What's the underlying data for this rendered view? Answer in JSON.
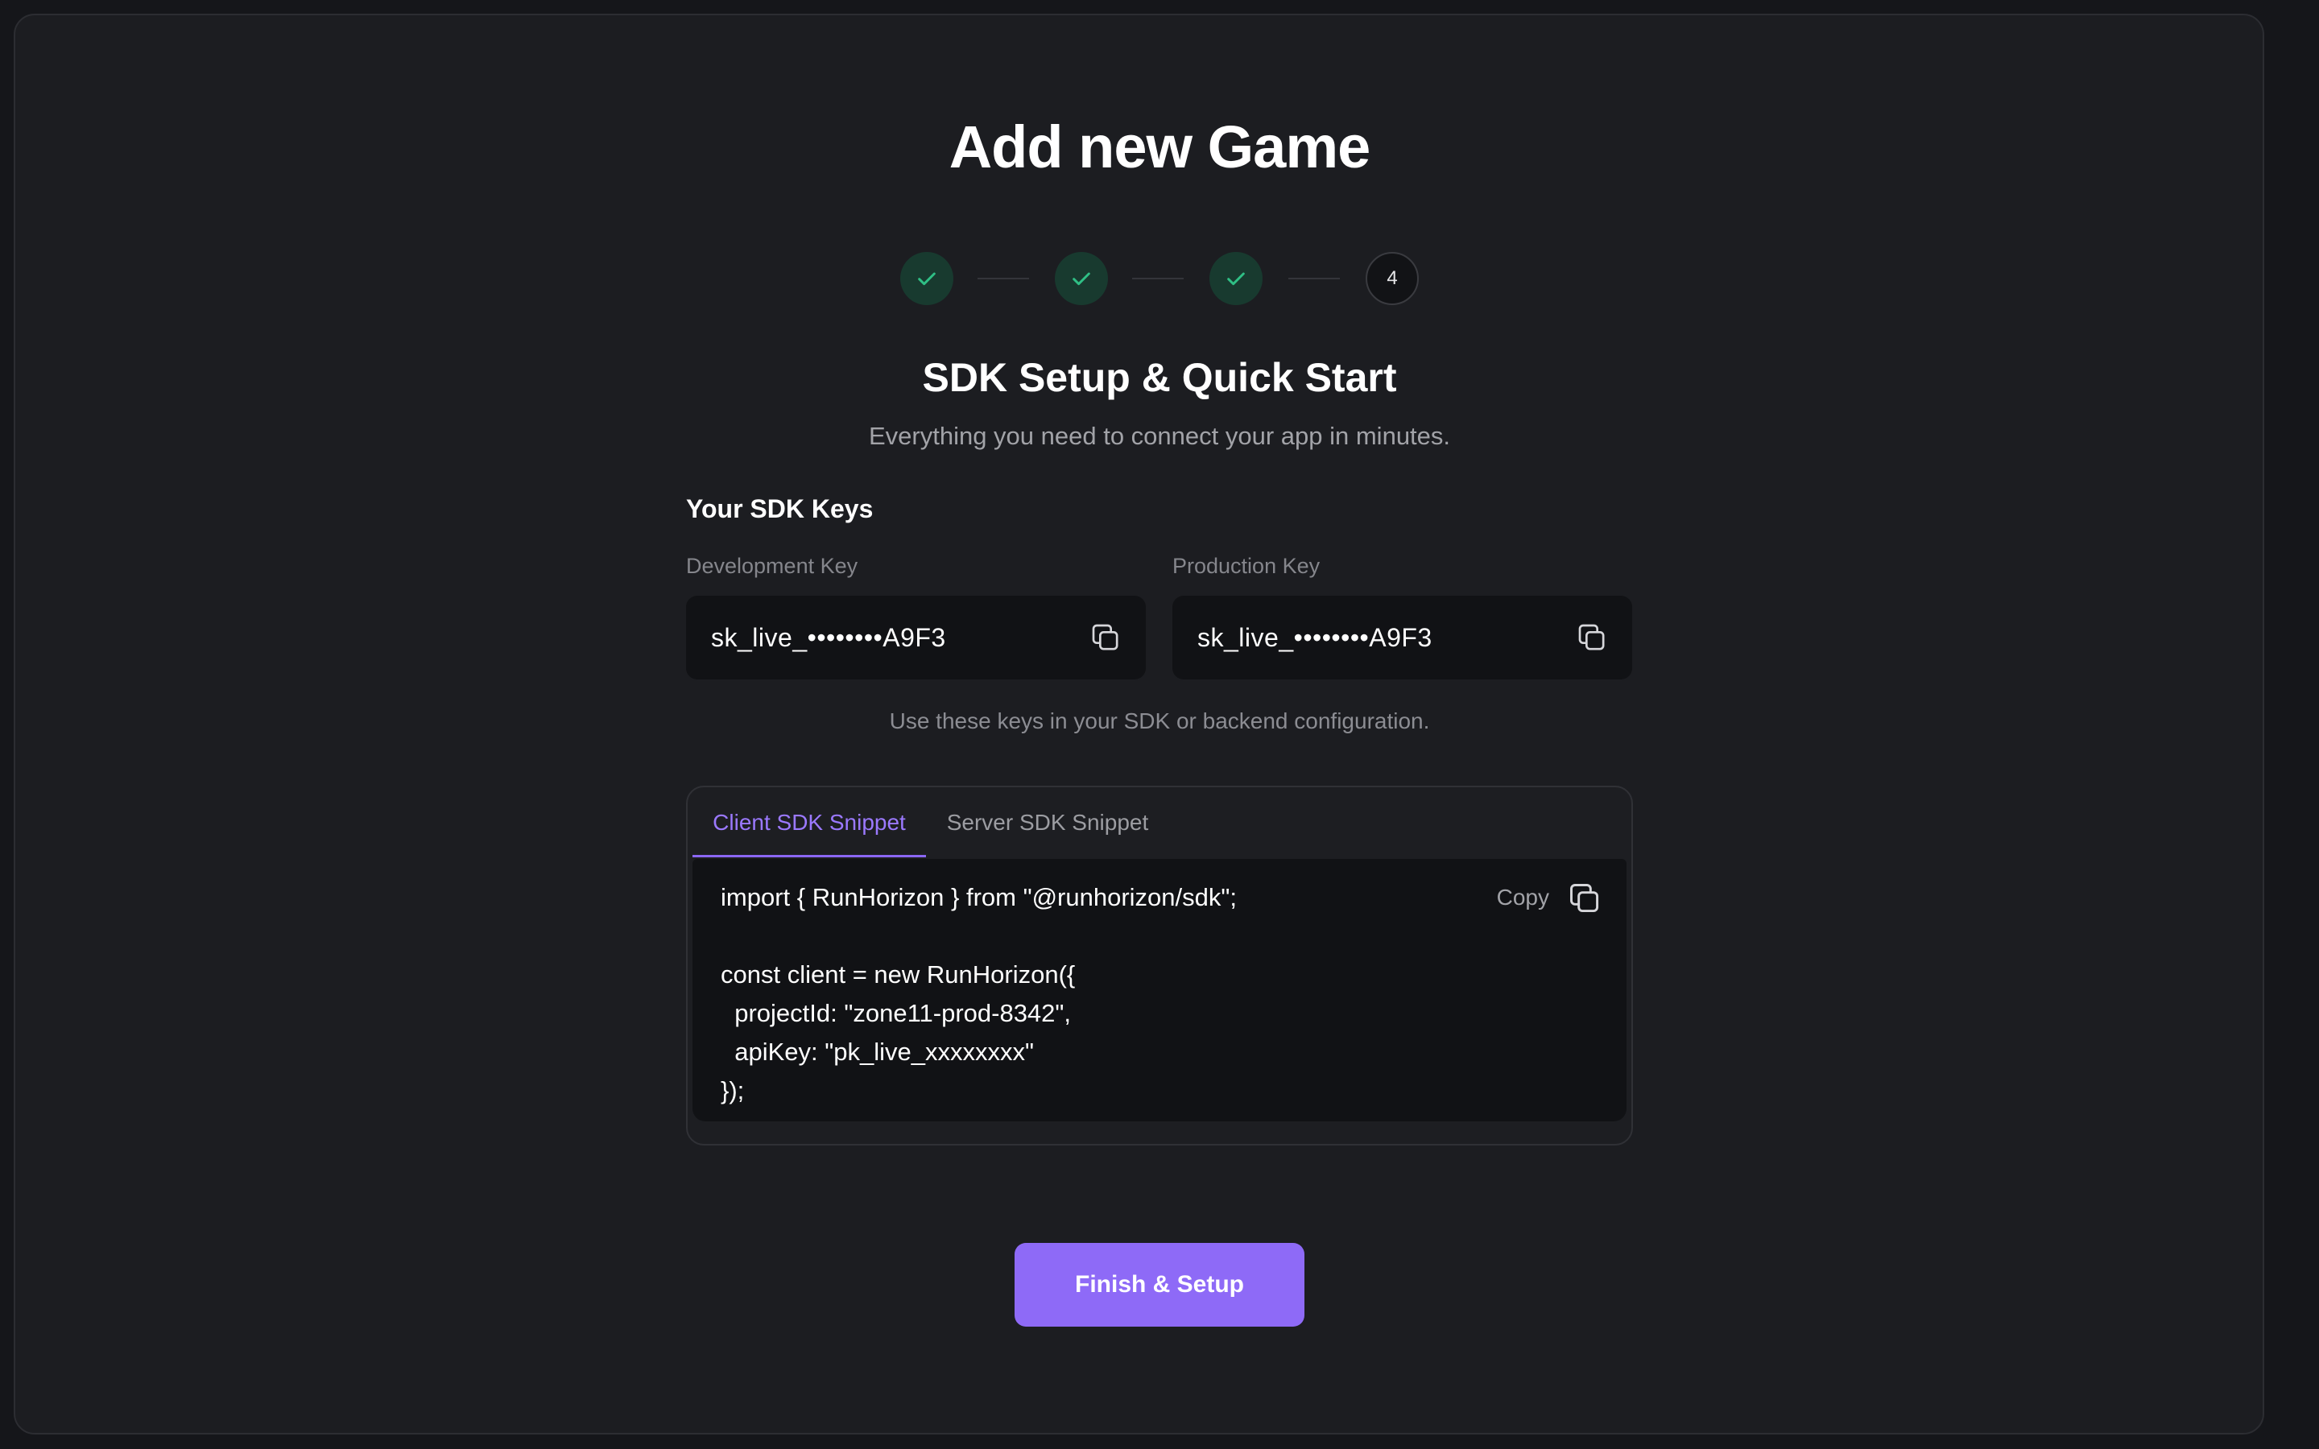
{
  "header": {
    "title": "Add new Game"
  },
  "stepper": {
    "steps": [
      {
        "state": "complete",
        "icon": "check-icon"
      },
      {
        "state": "complete",
        "icon": "check-icon"
      },
      {
        "state": "complete",
        "icon": "check-icon"
      },
      {
        "state": "current",
        "label": "4"
      }
    ]
  },
  "section": {
    "title": "SDK Setup & Quick Start",
    "subtitle": "Everything you need to connect your app in minutes."
  },
  "keys": {
    "heading": "Your SDK Keys",
    "development": {
      "label": "Development Key",
      "value": "sk_live_••••••••A9F3"
    },
    "production": {
      "label": "Production Key",
      "value": "sk_live_••••••••A9F3"
    },
    "hint": "Use these keys in your SDK or backend configuration."
  },
  "snippet": {
    "tabs": [
      {
        "label": "Client SDK Snippet",
        "active": true
      },
      {
        "label": "Server SDK Snippet",
        "active": false
      }
    ],
    "copy_label": "Copy",
    "lines": [
      "import { RunHorizon } from \"@runhorizon/sdk\";",
      "",
      "const client = new RunHorizon({",
      "  projectId: \"zone11-prod-8342\",",
      "  apiKey: \"pk_live_xxxxxxxx\"",
      "});"
    ]
  },
  "actions": {
    "finish_label": "Finish & Setup"
  },
  "colors": {
    "accent": "#8e6af7",
    "success": "#2fbf85",
    "background": "#1c1d21"
  }
}
